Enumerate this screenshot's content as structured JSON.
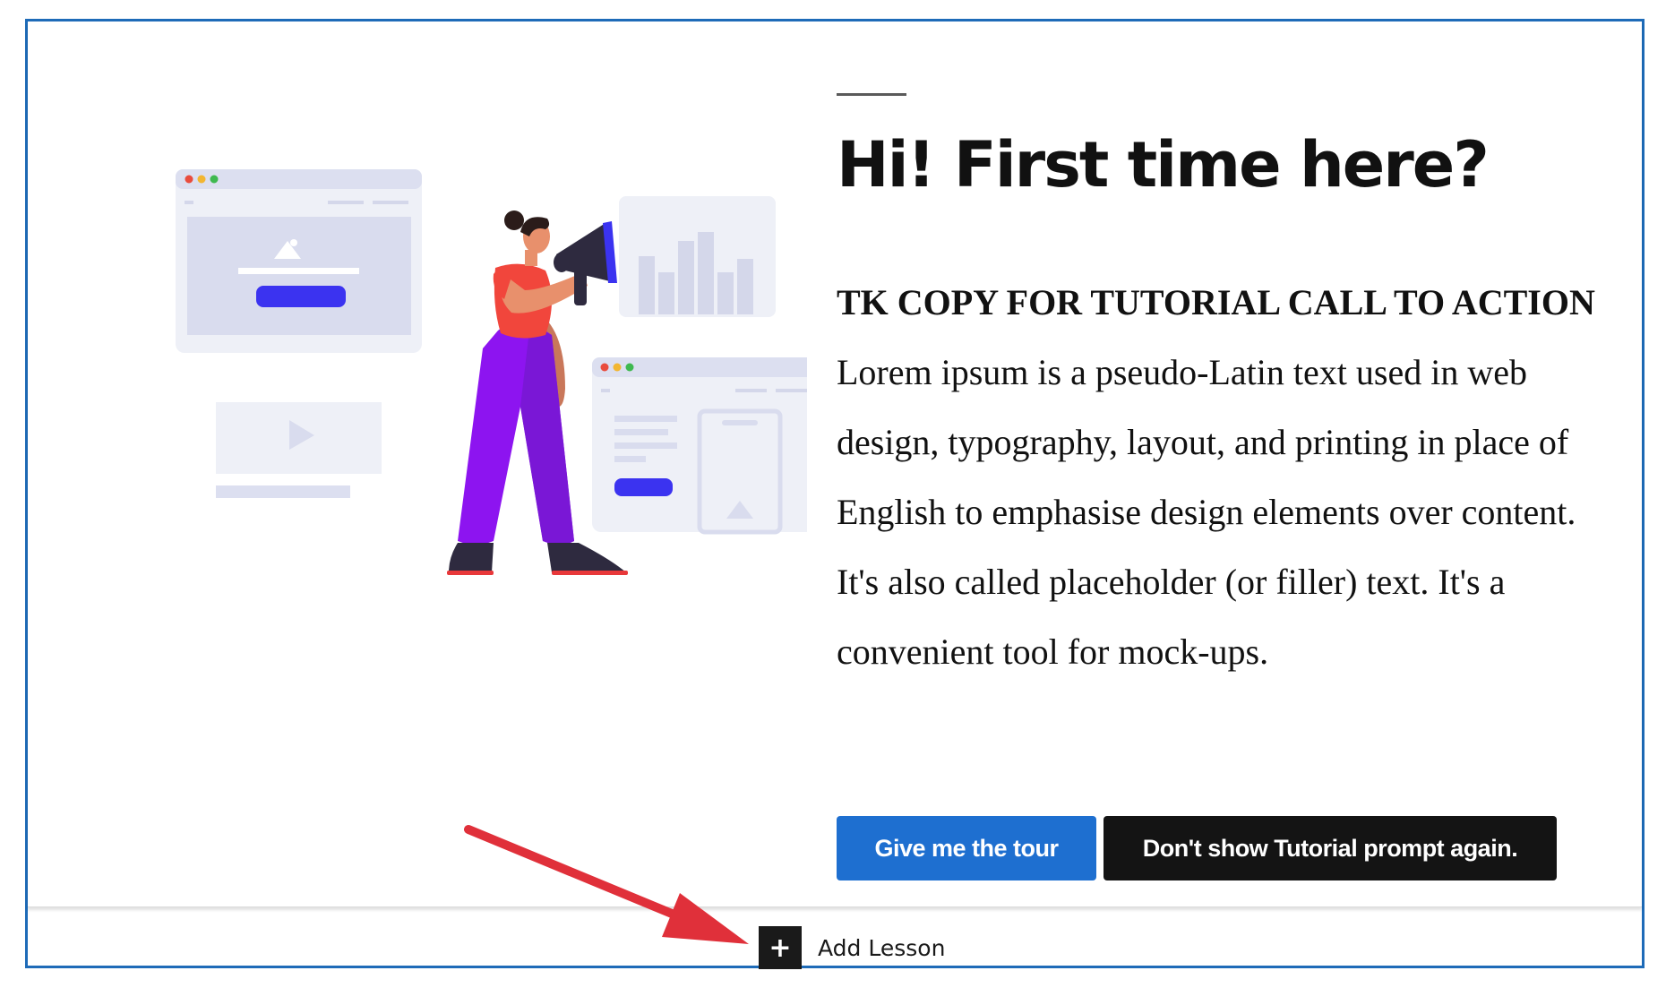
{
  "tutorial": {
    "headline": "Hi! First time here?",
    "body_lead": "TK COPY FOR TUTORIAL CALL TO ACTION",
    "body_text": " Lorem ipsum is a pseudo-Latin text used in web design, typography, layout, and printing in place of English to emphasise design elements over content. It's also called placeholder (or filler) text. It's a convenient tool for mock-ups.",
    "tour_button_label": "Give me the tour",
    "dismiss_button_label": "Don't show Tutorial prompt again."
  },
  "add_lesson": {
    "icon": "plus-icon",
    "icon_glyph": "+",
    "label": "Add Lesson"
  },
  "colors": {
    "accent_blue": "#1e6fd0",
    "frame_border": "#1e6bb8",
    "annotation_arrow": "#e0303a",
    "dark_button": "#141414"
  }
}
